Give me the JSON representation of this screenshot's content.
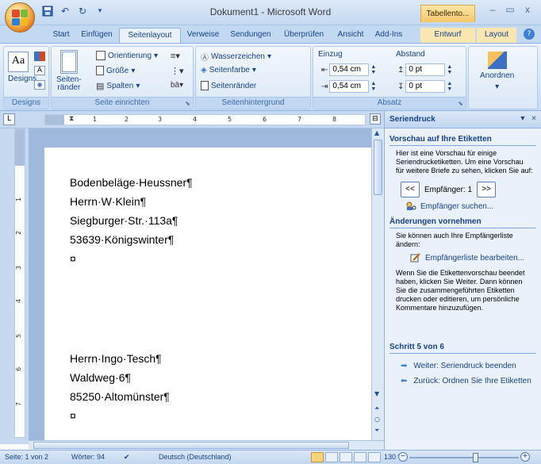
{
  "window": {
    "title": "Dokument1 - Microsoft Word",
    "context_tab_title": "Tabellento...",
    "controls": [
      "–",
      "▭",
      "x"
    ]
  },
  "tabs": [
    {
      "label": "Start",
      "active": false
    },
    {
      "label": "Einfügen",
      "active": false
    },
    {
      "label": "Seitenlayout",
      "active": true
    },
    {
      "label": "Verweise",
      "active": false
    },
    {
      "label": "Sendungen",
      "active": false
    },
    {
      "label": "Überprüfen",
      "active": false
    },
    {
      "label": "Ansicht",
      "active": false
    },
    {
      "label": "Add-Ins",
      "active": false
    },
    {
      "label": "Entwurf",
      "active": false
    },
    {
      "label": "Layout",
      "active": false
    }
  ],
  "ribbon": {
    "designs": {
      "label": "Designs",
      "button": "Designs"
    },
    "seite_einrichten": {
      "label": "Seite einrichten",
      "orientierung": "Orientierung",
      "groesse": "Größe",
      "spalten": "Spalten",
      "seitenraender": "Seiten-\nränder"
    },
    "seitenhintergrund": {
      "label": "Seitenhintergrund",
      "wasserzeichen": "Wasserzeichen",
      "seitenfarbe": "Seitenfarbe",
      "seitenraender": "Seitenränder"
    },
    "absatz": {
      "label": "Absatz",
      "einzug": "Einzug",
      "abstand": "Abstand",
      "einzug_links": "0,54 cm",
      "einzug_rechts": "0,54 cm",
      "abstand_vor": "0 pt",
      "abstand_nach": "0 pt"
    },
    "anordnen": {
      "label": "Anordnen"
    }
  },
  "ruler": {
    "h_numbers": [
      "1",
      "2",
      "3",
      "4",
      "5",
      "6",
      "7",
      "8"
    ],
    "v_numbers": [
      "1",
      "2",
      "3",
      "4",
      "5",
      "6",
      "7"
    ]
  },
  "document": {
    "label1": [
      "Bodenbeläge·Heussner¶",
      "Herrn·W·Klein¶",
      "Siegburger·Str.·113a¶",
      "53639·Königswinter¶",
      "¤"
    ],
    "label2": [
      "Herrn·Ingo·Tesch¶",
      "Waldweg·6¶",
      "85250·Altomünster¶",
      "¤"
    ]
  },
  "pane": {
    "title": "Seriendruck",
    "preview_title": "Vorschau auf Ihre Etiketten",
    "preview_text": "Hier ist eine Vorschau für einige Seriendrucketiketten. Um eine Vorschau für weitere Briefe zu sehen, klicken Sie auf:",
    "prev": "<<",
    "next": ">>",
    "recipient": "Empfänger: 1",
    "find_recipient": "Empfänger suchen...",
    "changes_title": "Änderungen vornehmen",
    "changes_text": "Sie können auch Ihre Empfängerliste ändern:",
    "edit_list": "Empfängerliste bearbeiten...",
    "finish_text": "Wenn Sie die Etikettenvorschau beendet haben, klicken Sie Weiter. Dann können Sie die zusammengeführten Etiketten drucken oder editieren, um persönliche Kommentare hinzuzufügen.",
    "step_title": "Schritt 5 von 6",
    "next_step": "Weiter: Seriendruck beenden",
    "prev_step": "Zurück: Ordnen Sie Ihre Etiketten"
  },
  "status": {
    "page": "Seite: 1 von 2",
    "words": "Wörter: 94",
    "language": "Deutsch (Deutschland)",
    "zoom": "130 %",
    "zoom_minus": "−",
    "zoom_plus": "+"
  }
}
